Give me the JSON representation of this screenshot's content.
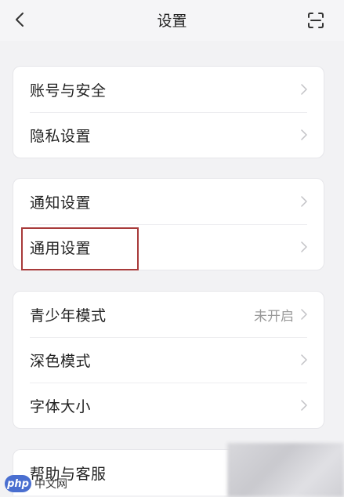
{
  "header": {
    "title": "设置",
    "back_icon": "chevron-left-icon",
    "scan_icon": "scan-icon"
  },
  "groups": [
    {
      "items": [
        {
          "label": "账号与安全"
        },
        {
          "label": "隐私设置"
        }
      ]
    },
    {
      "items": [
        {
          "label": "通知设置"
        },
        {
          "label": "通用设置",
          "highlighted": true
        }
      ]
    },
    {
      "items": [
        {
          "label": "青少年模式",
          "value": "未开启"
        },
        {
          "label": "深色模式"
        },
        {
          "label": "字体大小"
        }
      ]
    },
    {
      "items": [
        {
          "label": "帮助与客服"
        }
      ]
    }
  ],
  "watermark": {
    "logo": "php",
    "text": "中文网"
  },
  "colors": {
    "background": "#f2f2f4",
    "card": "#ffffff",
    "highlight_border": "#a83a3a",
    "secondary_text": "#999999"
  }
}
